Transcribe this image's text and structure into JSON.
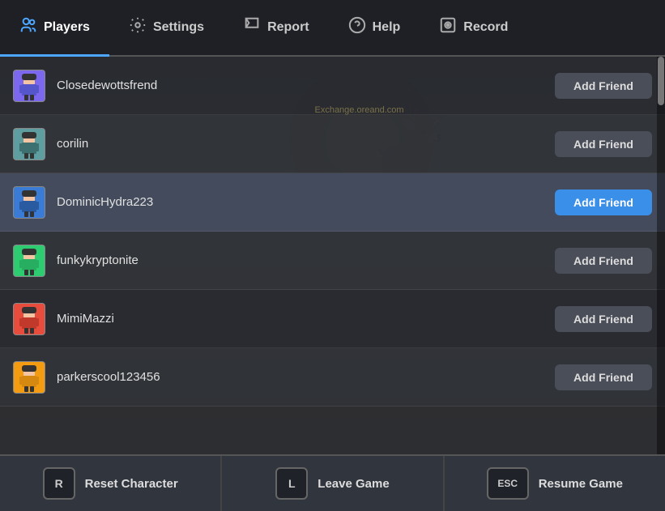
{
  "nav": {
    "items": [
      {
        "id": "players",
        "label": "Players",
        "icon": "👥",
        "active": true
      },
      {
        "id": "settings",
        "label": "Settings",
        "icon": "⚙️",
        "active": false
      },
      {
        "id": "report",
        "label": "Report",
        "icon": "🚩",
        "active": false
      },
      {
        "id": "help",
        "label": "Help",
        "icon": "❓",
        "active": false
      },
      {
        "id": "record",
        "label": "Record",
        "icon": "⊙",
        "active": false
      }
    ]
  },
  "players": [
    {
      "id": 1,
      "name": "Closedewottsfrend",
      "avatar": "🧑",
      "addFriend": "Add Friend",
      "highlighted": false,
      "activeBlue": false
    },
    {
      "id": 2,
      "name": "corilin",
      "avatar": "🧑",
      "addFriend": "Add Friend",
      "highlighted": false,
      "activeBlue": false
    },
    {
      "id": 3,
      "name": "DominicHydra223",
      "avatar": "🧑",
      "addFriend": "Add Friend",
      "highlighted": true,
      "activeBlue": true
    },
    {
      "id": 4,
      "name": "funkykryptonite",
      "avatar": "🧑",
      "addFriend": "Add Friend",
      "highlighted": false,
      "activeBlue": false
    },
    {
      "id": 5,
      "name": "MimiMazzi",
      "avatar": "🧑",
      "addFriend": "Add Friend",
      "highlighted": false,
      "activeBlue": false
    },
    {
      "id": 6,
      "name": "parkerscool123456",
      "avatar": "🧑",
      "addFriend": "Add Friend",
      "highlighted": false,
      "activeBlue": false
    }
  ],
  "watermark": "Exchange.oreand.com",
  "actions": [
    {
      "id": "reset",
      "key": "R",
      "label": "Reset Character"
    },
    {
      "id": "leave",
      "key": "L",
      "label": "Leave Game"
    },
    {
      "id": "resume",
      "key": "ESC",
      "label": "Resume Game"
    }
  ]
}
